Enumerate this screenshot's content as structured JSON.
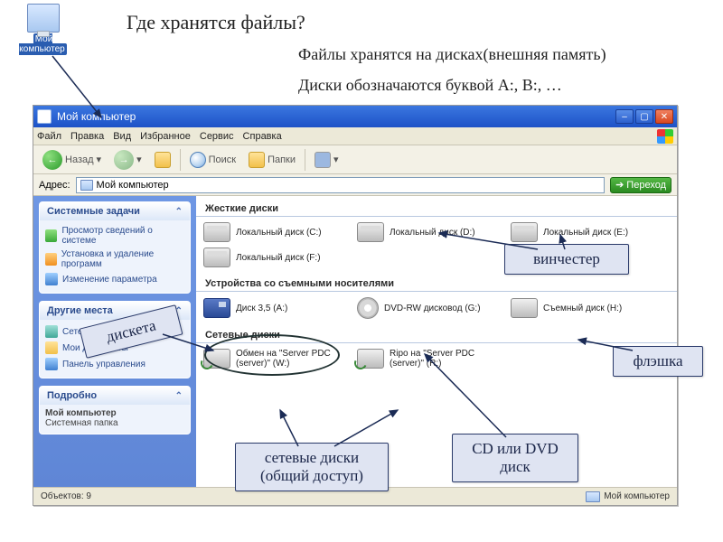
{
  "desktop_icon_label": "Мой\nкомпьютер",
  "heading": "Где хранятся файлы?",
  "sub1": "Файлы хранятся на дисках(внешняя память)",
  "sub2": "Диски обозначаются буквой A:, B:, …",
  "window": {
    "title": "Мой компьютер",
    "menu": [
      "Файл",
      "Правка",
      "Вид",
      "Избранное",
      "Сервис",
      "Справка"
    ],
    "toolbar": {
      "back": "Назад",
      "search": "Поиск",
      "folders": "Папки"
    },
    "address_label": "Адрес:",
    "address_value": "Мой компьютер",
    "go": "Переход",
    "sidebar": {
      "tasks_title": "Системные задачи",
      "tasks": [
        "Просмотр сведений о системе",
        "Установка и удаление программ",
        "Изменение параметра"
      ],
      "places_title": "Другие места",
      "places": [
        "Сетевое окружение",
        "Мои документы",
        "Панель управления"
      ],
      "details_title": "Подробно",
      "details_name": "Мой компьютер",
      "details_type": "Системная папка"
    },
    "groups": {
      "hdd": "Жесткие диски",
      "removable": "Устройства со съемными носителями",
      "network": "Сетевые диски"
    },
    "drives": {
      "c": "Локальный диск (C:)",
      "d": "Локальный диск (D:)",
      "e": "Локальный диск (E:)",
      "f": "Локальный диск (F:)",
      "a": "Диск 3,5 (A:)",
      "g": "DVD-RW дисковод (G:)",
      "h": "Съемный диск (H:)",
      "w": "Обмен на \"Server PDC (server)\" (W:)",
      "r": "Ripo на \"Server PDC (server)\" (R:)"
    },
    "status_left": "Объектов: 9",
    "status_right": "Мой компьютер"
  },
  "annotations": {
    "hdd": "винчестер",
    "usb": "флэшка",
    "cd": "CD или DVD диск",
    "net": "сетевые диски (общий доступ)",
    "floppy": "дискета"
  }
}
